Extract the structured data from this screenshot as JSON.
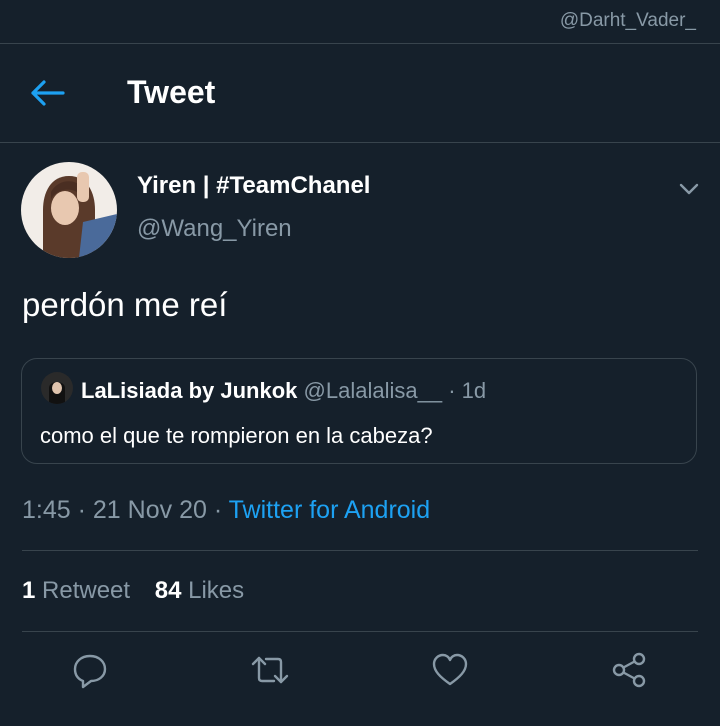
{
  "watermark": "@Darht_Vader_",
  "header": {
    "title": "Tweet",
    "back_icon": "arrow-left-icon"
  },
  "tweet": {
    "author_name": "Yiren | #TeamChanel",
    "author_handle": "@Wang_Yiren",
    "text": "perdón me reí",
    "quote": {
      "author_name": "LaLisiada by Junkok",
      "author_handle": "@Lalalalisa__",
      "time": "· 1d",
      "text": "como el que te rompieron en la cabeza?"
    },
    "time": "1:45",
    "date": "21 Nov 20",
    "source": "Twitter for Android",
    "retweet_count": "1",
    "retweet_label": "Retweet",
    "like_count": "84",
    "like_label": "Likes"
  },
  "actions": [
    "reply-icon",
    "retweet-icon",
    "like-icon",
    "share-icon"
  ],
  "colors": {
    "background": "#15202b",
    "accent": "#1da1f2",
    "secondary_text": "#8899a6",
    "divider": "#38444d"
  }
}
